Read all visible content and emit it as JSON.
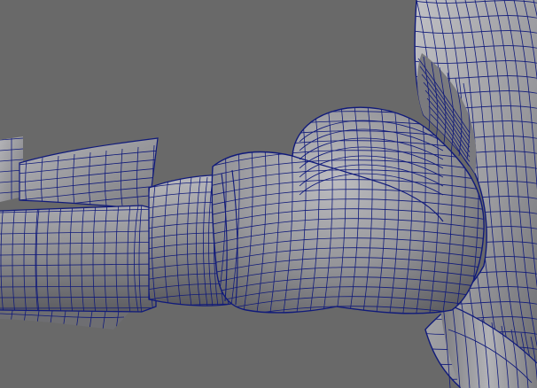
{
  "viewport": {
    "background": "#696969",
    "shading_base": "#8f8f8f",
    "wire_color": "#101a7a"
  }
}
